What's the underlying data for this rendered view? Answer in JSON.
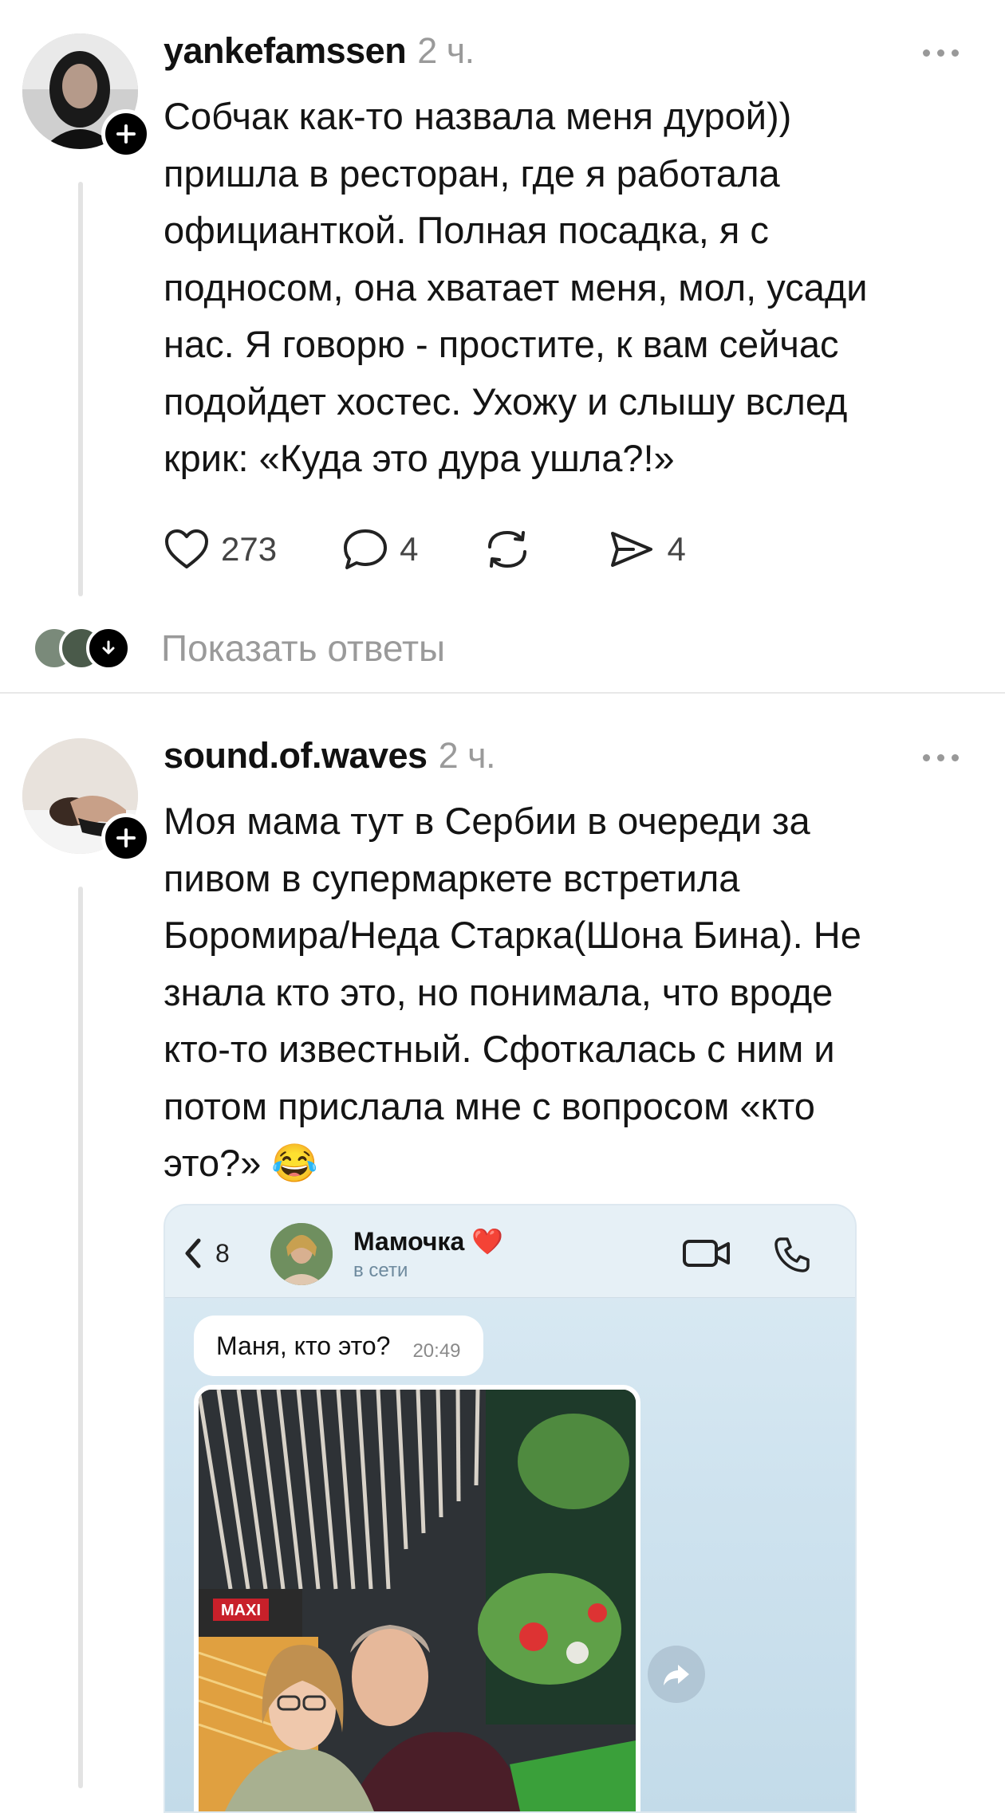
{
  "posts": [
    {
      "username": "yankefamssen",
      "time": "2 ч.",
      "text": "Собчак как-то назвала меня дурой))\nпришла в ресторан, где я работала\nофицианткой. Полная посадка, я с\nподносом, она хватает меня, мол, усади\nнас. Я говорю - простите, к вам сейчас\nподойдет хостес. Ухожу и слышу вслед\nкрик: «Куда это дура ушла?!»",
      "likes": "273",
      "comments": "4",
      "reposts": "",
      "shares": "4",
      "replies_label": "Показать ответы"
    },
    {
      "username": "sound.of.waves",
      "time": "2 ч.",
      "text": "Моя мама тут в Сербии в очереди за\nпивом в супермаркете встретила\nБоромира/Неда Старка(Шона Бина). Не\nзнала кто это, но понимала, что вроде\nкто-то известный. Сфоткалась с ним и\nпотом прислала мне с вопросом «кто\nэто?» 😂"
    }
  ],
  "chat": {
    "back_count": "8",
    "contact_name": "Мамочка ❤️",
    "contact_status": "в сети",
    "message": "Маня, кто это?",
    "message_time": "20:49",
    "photo_sign": "MAXI"
  },
  "colors": {
    "accent": "#000000",
    "muted": "#9a9a9a",
    "divider": "#e8e8e8"
  }
}
